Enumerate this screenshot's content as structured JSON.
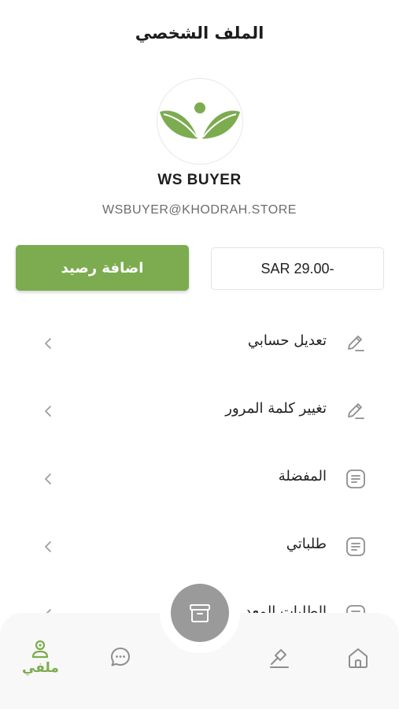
{
  "header": {
    "title": "الملف الشخصي"
  },
  "profile": {
    "username": "WS BUYER",
    "email": "WSBUYER@KHODRAH.STORE"
  },
  "wallet": {
    "balance": "SAR 29.00-",
    "add_balance_label": "اضافة رصيد"
  },
  "menu": {
    "items": [
      {
        "label": "تعديل حسابي",
        "icon": "pencil-icon"
      },
      {
        "label": "تغيير كلمة المرور",
        "icon": "pencil-icon"
      },
      {
        "label": "المفضلة",
        "icon": "list-icon"
      },
      {
        "label": "طلباتي",
        "icon": "list-icon"
      },
      {
        "label": "الطلبات المعد",
        "icon": "list-icon"
      }
    ]
  },
  "bottom_nav": {
    "items": [
      {
        "name": "home",
        "icon": "home-icon"
      },
      {
        "name": "auction",
        "icon": "gavel-icon"
      },
      {
        "name": "center",
        "icon": "box-icon"
      },
      {
        "name": "chat",
        "icon": "chat-icon"
      },
      {
        "name": "profile",
        "icon": "person-icon",
        "label": "ملفي",
        "active": true
      }
    ]
  },
  "colors": {
    "accent": "#7cac4f",
    "icon_gray": "#8e8e8e",
    "fab": "#9a9a9a"
  }
}
